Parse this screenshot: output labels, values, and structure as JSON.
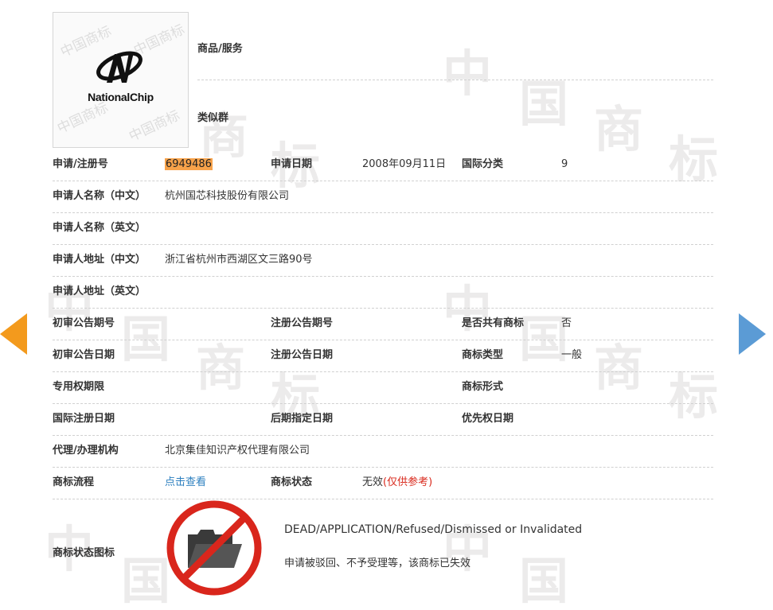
{
  "goods_services": {
    "label": "商品/服务"
  },
  "similar_group": {
    "label": "类似群"
  },
  "logo": {
    "text": "NationalChip",
    "wm": "中国商标"
  },
  "watermark": {
    "chars": [
      "中",
      "国",
      "商",
      "标"
    ]
  },
  "rows": {
    "reg_no": {
      "label": "申请/注册号",
      "value": "6949486",
      "date_label": "申请日期",
      "date_value": "2008年09月11日",
      "class_label": "国际分类",
      "class_value": "9"
    },
    "applicant_cn": {
      "label": "申请人名称（中文）",
      "value": "杭州国芯科技股份有限公司"
    },
    "applicant_en": {
      "label": "申请人名称（英文）"
    },
    "address_cn": {
      "label": "申请人地址（中文）",
      "value": "浙江省杭州市西湖区文三路90号"
    },
    "address_en": {
      "label": "申请人地址（英文）"
    },
    "prelim_no": {
      "label": "初审公告期号",
      "reg_label": "注册公告期号",
      "shared_label": "是否共有商标",
      "shared_value": "否"
    },
    "prelim_date": {
      "label": "初审公告日期",
      "reg_label": "注册公告日期",
      "type_label": "商标类型",
      "type_value": "一般"
    },
    "exclusive": {
      "label": "专用权期限",
      "form_label": "商标形式"
    },
    "intl_reg": {
      "label": "国际注册日期",
      "later_label": "后期指定日期",
      "priority_label": "优先权日期"
    },
    "agent": {
      "label": "代理/办理机构",
      "value": "北京集佳知识产权代理有限公司"
    },
    "process": {
      "label": "商标流程",
      "link": "点击查看",
      "status_label": "商标状态",
      "status_value": "无效",
      "status_note": "(仅供参考)"
    },
    "status_icon": {
      "label": "商标状态图标",
      "en": "DEAD/APPLICATION/Refused/Dismissed or Invalidated",
      "cn": "申请被驳回、不予受理等，该商标已失效"
    }
  },
  "colors": {
    "highlight": "#f7a24a",
    "link": "#2c7fbf",
    "red": "#d9291c",
    "arrow_left": "#f39a1d",
    "arrow_right": "#5b9bd5"
  }
}
